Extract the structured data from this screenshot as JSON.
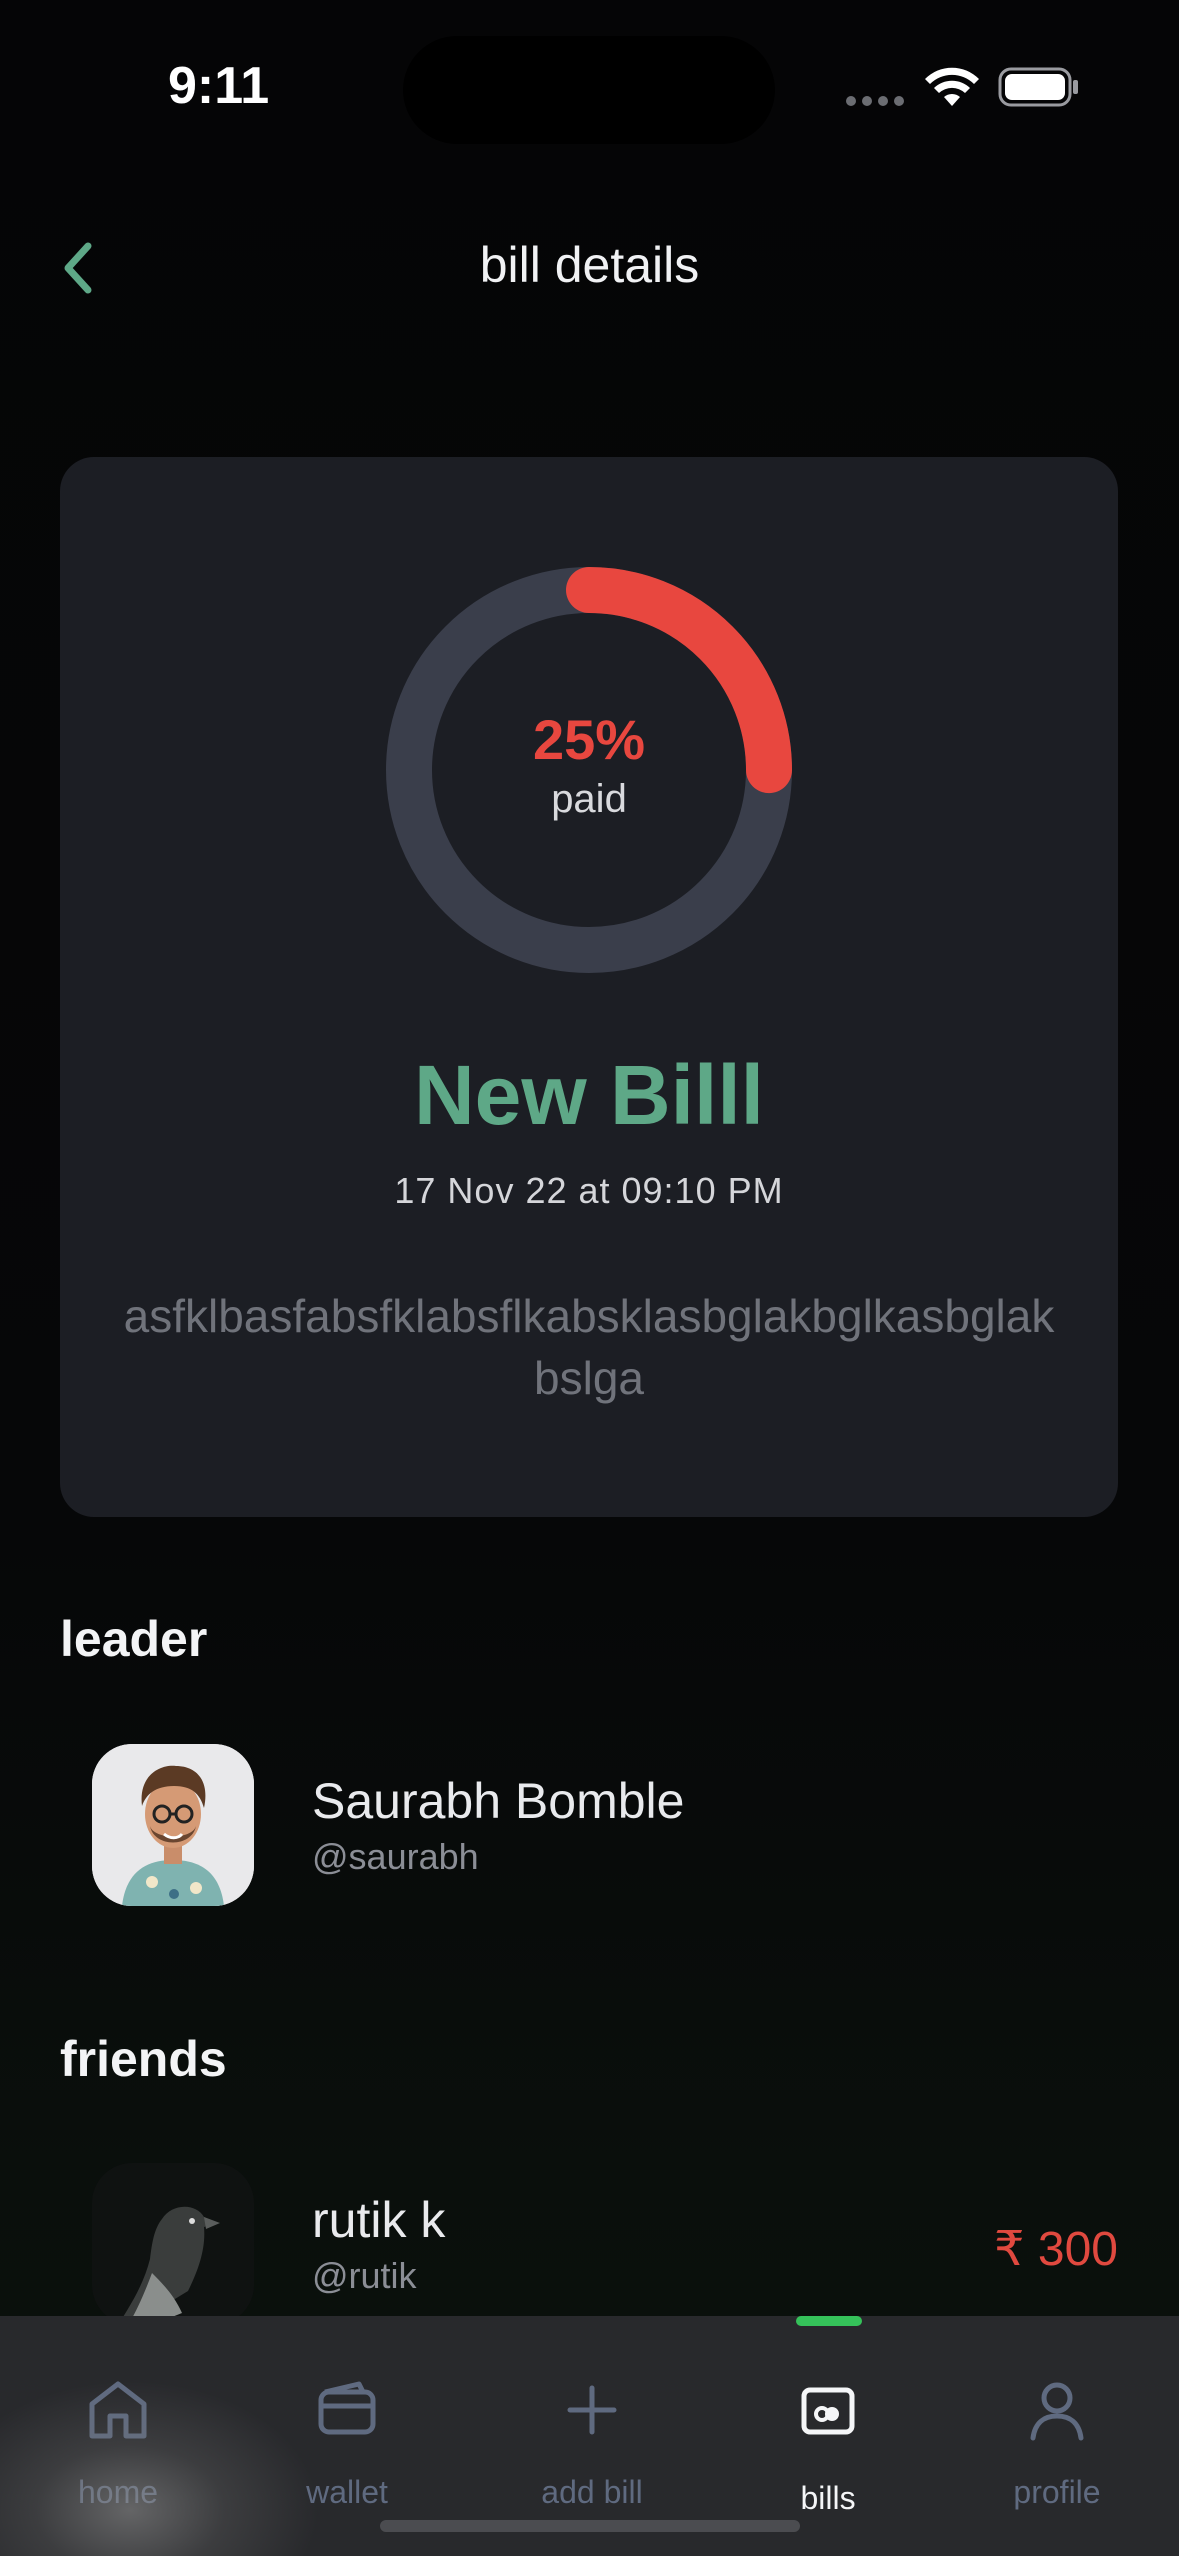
{
  "status_bar": {
    "time": "9:11"
  },
  "header": {
    "title": "bill details",
    "back_icon": "chevron-left-icon"
  },
  "bill": {
    "paid_percent_label": "25%",
    "paid_fraction": 0.25,
    "paid_sub_label": "paid",
    "name": "New Billl",
    "date": "17 Nov 22 at 09:10 PM",
    "description": "asfklbasfabsfklabsflkabsklasbglakbglkasbglakbslga"
  },
  "colors": {
    "accent_green": "#5ea887",
    "paid_red": "#e8473f",
    "ring_track": "#3a3e4b",
    "tab_active_indicator": "#35c25a"
  },
  "leader": {
    "section_title": "leader",
    "name": "Saurabh Bomble",
    "handle": "@saurabh"
  },
  "friends": {
    "section_title": "friends",
    "items": [
      {
        "name": "rutik k",
        "handle": "@rutik",
        "amount": "₹ 300"
      }
    ]
  },
  "tabbar": {
    "tabs": [
      {
        "label": "home",
        "icon": "home-icon"
      },
      {
        "label": "wallet",
        "icon": "wallet-icon"
      },
      {
        "label": "add bill",
        "icon": "plus-icon"
      },
      {
        "label": "bills",
        "icon": "bills-icon",
        "active": true
      },
      {
        "label": "profile",
        "icon": "profile-icon"
      }
    ]
  }
}
